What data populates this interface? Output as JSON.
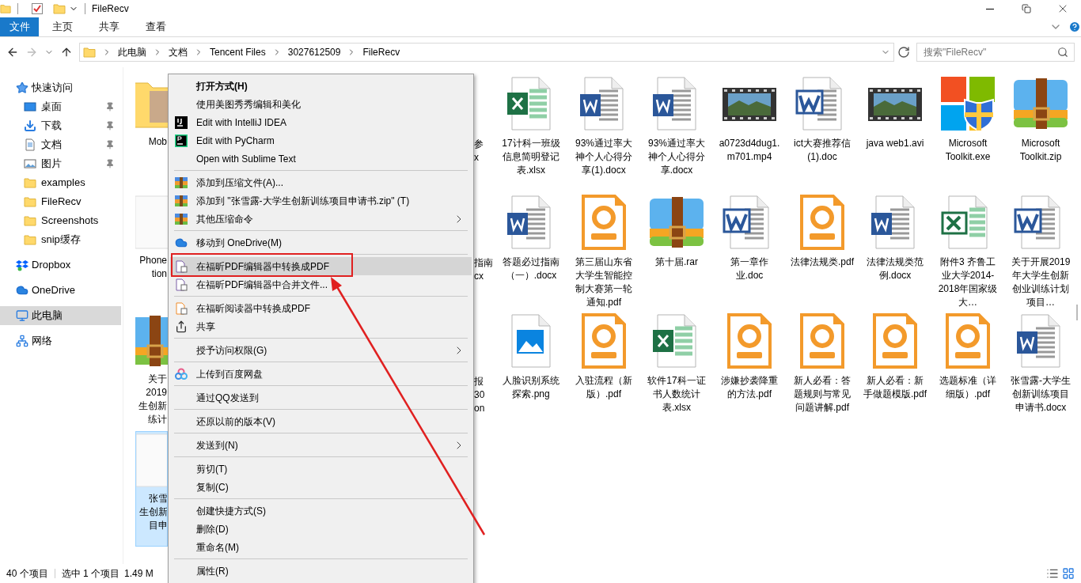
{
  "window": {
    "title": "FileRecv"
  },
  "ribbon_tabs": [
    {
      "label": "文件",
      "selected": true
    },
    {
      "label": "主页",
      "selected": false
    },
    {
      "label": "共享",
      "selected": false
    },
    {
      "label": "查看",
      "selected": false
    }
  ],
  "address": {
    "crumbs": [
      "此电脑",
      "文档",
      "Tencent Files",
      "3027612509",
      "FileRecv"
    ]
  },
  "search": {
    "placeholder": "搜索\"FileRecv\""
  },
  "sidebar": [
    {
      "label": "快速访问",
      "kind": "star",
      "selected": false,
      "children": [
        {
          "label": "桌面",
          "kind": "desktop",
          "pinned": true,
          "selected": false
        },
        {
          "label": "下载",
          "kind": "download",
          "pinned": true,
          "selected": false
        },
        {
          "label": "文档",
          "kind": "document",
          "pinned": true,
          "selected": false
        },
        {
          "label": "图片",
          "kind": "picture",
          "pinned": true,
          "selected": false
        },
        {
          "label": "examples",
          "kind": "folder",
          "pinned": false,
          "selected": false
        },
        {
          "label": "FileRecv",
          "kind": "folder",
          "pinned": false,
          "selected": false
        },
        {
          "label": "Screenshots",
          "kind": "folder",
          "pinned": false,
          "selected": false
        },
        {
          "label": "snip缓存",
          "kind": "folder",
          "pinned": false,
          "selected": false
        }
      ]
    },
    {
      "label": "Dropbox",
      "kind": "dropbox",
      "selected": false
    },
    {
      "label": "OneDrive",
      "kind": "cloud",
      "selected": false
    },
    {
      "label": "此电脑",
      "kind": "computer",
      "selected": true
    },
    {
      "label": "网络",
      "kind": "network",
      "selected": false
    }
  ],
  "partial_left_column": [
    {
      "kind": "folder",
      "lines": [
        "Mob"
      ],
      "selected": false
    },
    {
      "kind": "blank",
      "lines": [
        "Phone",
        "tion"
      ],
      "selected": false
    },
    {
      "kind": "zip",
      "lines": [
        "关于",
        "2019",
        "生创新",
        "练计"
      ],
      "selected": false
    },
    {
      "kind": "blank",
      "lines": [
        "张雪",
        "生创新",
        "目申"
      ],
      "selected": true
    }
  ],
  "partial_right_strip": [
    [
      "参",
      "x"
    ],
    [
      "指南",
      "cx"
    ],
    [
      "报",
      "30",
      "on"
    ]
  ],
  "files": [
    [
      {
        "kind": "excel",
        "name": "17计科一班级信息简明登记表.xlsx"
      },
      {
        "kind": "word",
        "name": "93%通过率大神个人心得分享(1).docx"
      },
      {
        "kind": "word",
        "name": "93%通过率大神个人心得分享.docx"
      },
      {
        "kind": "video",
        "name": "a0723d4dug1.m701.mp4"
      },
      {
        "kind": "word_classic",
        "name": "ict大赛推荐信 (1).doc"
      },
      {
        "kind": "video",
        "name": "java web1.avi"
      },
      {
        "kind": "exe",
        "name": "Microsoft Toolkit.exe"
      },
      {
        "kind": "zip",
        "name": "Microsoft Toolkit.zip"
      }
    ],
    [
      {
        "kind": "word",
        "name": "答题必过指南（一）.docx"
      },
      {
        "kind": "pdf",
        "name": "第三届山东省大学生智能控制大赛第一轮通知.pdf"
      },
      {
        "kind": "zip",
        "name": "第十届.rar"
      },
      {
        "kind": "word_classic",
        "name": "第一章作业.doc"
      },
      {
        "kind": "pdf",
        "name": "法律法规类.pdf"
      },
      {
        "kind": "word",
        "name": "法律法规类范例.docx"
      },
      {
        "kind": "excel_classic",
        "name": "附件3 齐鲁工业大学2014-2018年国家级大…"
      },
      {
        "kind": "word_classic",
        "name": "关于开展2019年大学生创新创业训练计划项目…"
      }
    ],
    [
      {
        "kind": "image",
        "name": "人脸识别系统探索.png"
      },
      {
        "kind": "pdf",
        "name": "入驻流程（新版）.pdf"
      },
      {
        "kind": "excel",
        "name": "软件17科一证书人数统计表.xlsx"
      },
      {
        "kind": "pdf",
        "name": "涉嫌抄袭降重的方法.pdf"
      },
      {
        "kind": "pdf",
        "name": "新人必看：答题规则与常见问题讲解.pdf"
      },
      {
        "kind": "pdf",
        "name": "新人必看：新手做题模版.pdf"
      },
      {
        "kind": "pdf",
        "name": "选题标准（详细版）.pdf"
      },
      {
        "kind": "word",
        "name": "张雪露-大学生创新训练项目申请书.docx"
      }
    ]
  ],
  "context_menu": [
    {
      "kind": "item",
      "label": "打开方式(H)",
      "bold": true
    },
    {
      "kind": "item",
      "label": "使用美图秀秀编辑和美化"
    },
    {
      "kind": "ij",
      "label": "Edit with IntelliJ IDEA"
    },
    {
      "kind": "pc",
      "label": "Edit with PyCharm"
    },
    {
      "kind": "item",
      "label": "Open with Sublime Text"
    },
    {
      "kind": "separator"
    },
    {
      "kind": "archive",
      "label": "添加到压缩文件(A)..."
    },
    {
      "kind": "archive",
      "label": "添加到 \"张雪露-大学生创新训练项目申请书.zip\" (T)"
    },
    {
      "kind": "archive",
      "label": "其他压缩命令",
      "submenu": true
    },
    {
      "kind": "separator"
    },
    {
      "kind": "cloud",
      "label": "移动到 OneDrive(M)"
    },
    {
      "kind": "separator"
    },
    {
      "kind": "pdfdoc",
      "label": "在福昕PDF编辑器中转换成PDF",
      "highlighted": true
    },
    {
      "kind": "pdfmerge",
      "label": "在福昕PDF编辑器中合并文件..."
    },
    {
      "kind": "separator"
    },
    {
      "kind": "pdfreader",
      "label": "在福昕阅读器中转换成PDF"
    },
    {
      "kind": "share",
      "label": "共享"
    },
    {
      "kind": "separator"
    },
    {
      "kind": "item",
      "label": "授予访问权限(G)",
      "submenu": true
    },
    {
      "kind": "separator"
    },
    {
      "kind": "baidu",
      "label": "上传到百度网盘"
    },
    {
      "kind": "separator"
    },
    {
      "kind": "item",
      "label": "通过QQ发送到"
    },
    {
      "kind": "separator"
    },
    {
      "kind": "item",
      "label": "还原以前的版本(V)"
    },
    {
      "kind": "separator"
    },
    {
      "kind": "item",
      "label": "发送到(N)",
      "submenu": true
    },
    {
      "kind": "separator"
    },
    {
      "kind": "item",
      "label": "剪切(T)"
    },
    {
      "kind": "item",
      "label": "复制(C)"
    },
    {
      "kind": "separator"
    },
    {
      "kind": "item",
      "label": "创建快捷方式(S)"
    },
    {
      "kind": "item",
      "label": "删除(D)"
    },
    {
      "kind": "item",
      "label": "重命名(M)"
    },
    {
      "kind": "separator"
    },
    {
      "kind": "item",
      "label": "属性(R)"
    }
  ],
  "status_bar": {
    "count": "40 个项目",
    "selection": "选中 1 个项目",
    "size": "1.49 M"
  }
}
